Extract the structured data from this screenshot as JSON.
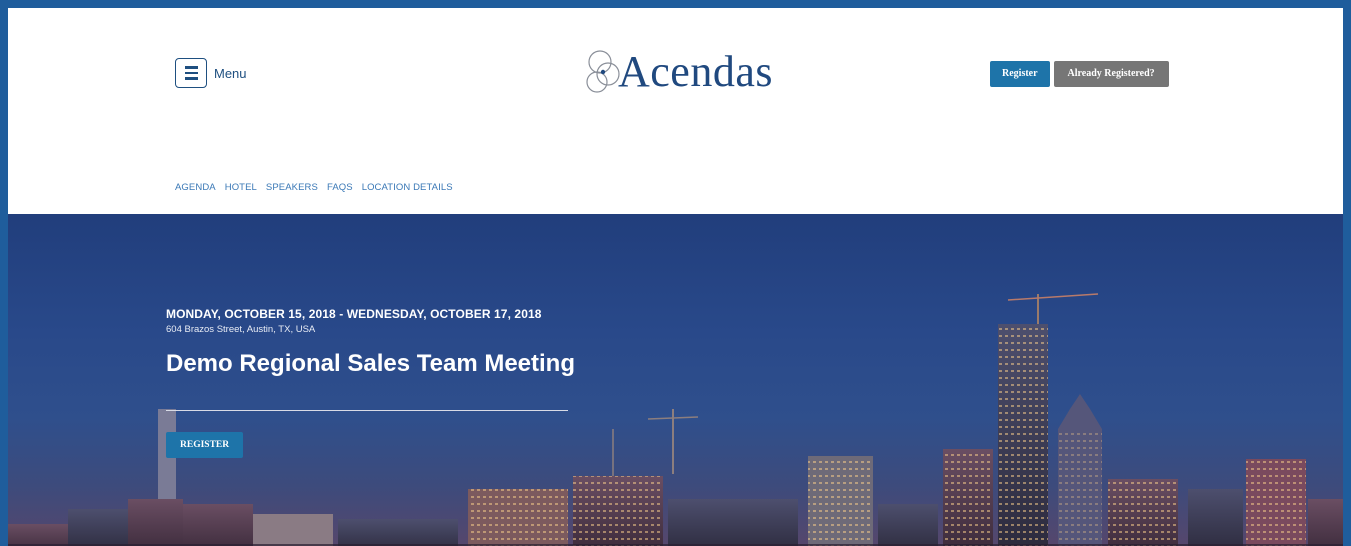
{
  "header": {
    "menu_label": "Menu",
    "logo_text": "Acendas",
    "register_label": "Register",
    "already_registered_label": "Already Registered?"
  },
  "nav": {
    "items": [
      "AGENDA",
      "HOTEL",
      "SPEAKERS",
      "FAQS",
      "LOCATION DETAILS"
    ]
  },
  "hero": {
    "date_range": "MONDAY, OCTOBER 15, 2018 - WEDNESDAY, OCTOBER 17, 2018",
    "address": "604 Brazos Street, Austin, TX, USA",
    "title": "Demo Regional Sales Team Meeting",
    "register_label": "REGISTER"
  },
  "colors": {
    "frame": "#1f5d9c",
    "brand_blue": "#20497f",
    "button_blue": "#1e74a9",
    "button_gray": "#767676",
    "nav_link": "#3a78b6"
  }
}
